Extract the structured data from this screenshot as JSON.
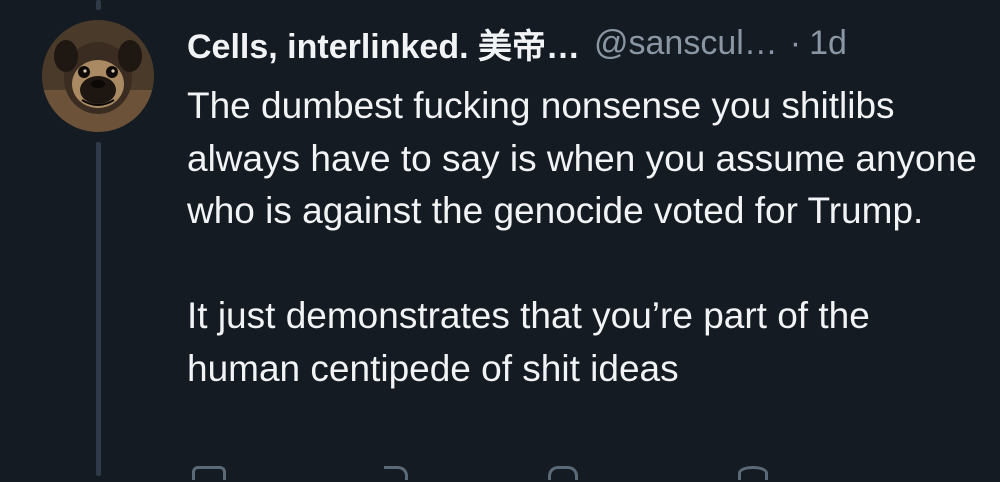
{
  "post": {
    "author": {
      "display_name": "Cells, interlinked. 美帝…",
      "handle": "@sanscul…",
      "avatar": "pug-dog-avatar"
    },
    "separator": "·",
    "time": "1d",
    "body": [
      "The dumbest fucking nonsense you shitlibs always have to say is when you assume anyone who is against the genocide voted for Trump.",
      "It just demonstrates that you’re part of the human centipede of shit ideas"
    ]
  },
  "actions": [
    "reply-icon",
    "repost-icon",
    "like-icon",
    "more-icon"
  ],
  "colors": {
    "background": "#151b23",
    "text": "#f1f3f5",
    "muted": "#8a96a3",
    "thread_line": "#2e3a47"
  }
}
